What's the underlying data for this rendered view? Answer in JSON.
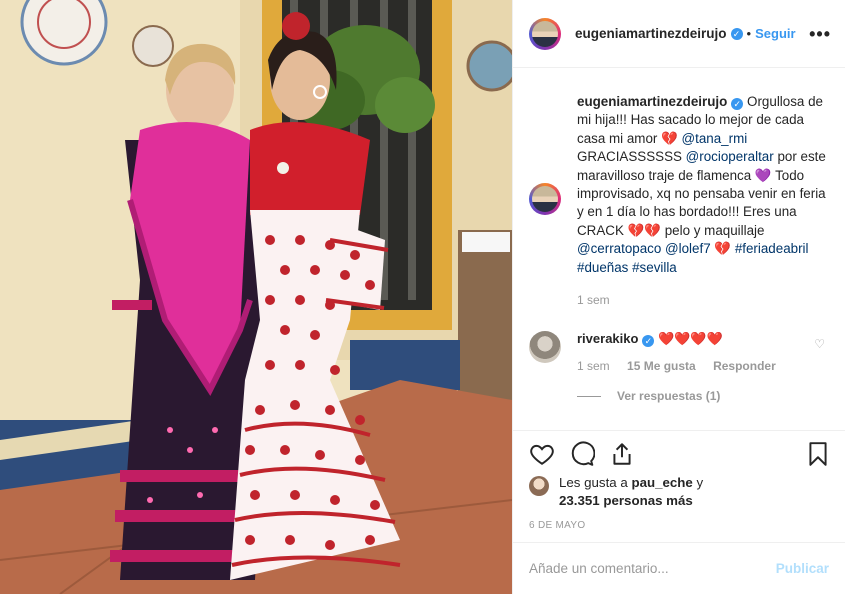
{
  "post": {
    "username": "eugeniamartinezdeirujo",
    "follow_label": "Seguir",
    "more_glyph": "•••",
    "caption_text_1": "Orgullosa de mi hija!!! Has sacado lo mejor de cada casa mi amor",
    "caption_mention_1": "@tana_rmi",
    "caption_text_2": "GRACIASSSSSS",
    "caption_mention_2": "@rocioperaltar",
    "caption_text_3": "por este maravilloso traje de flamenca",
    "caption_text_4": "Todo improvisado, xq no pensaba venir en feria y en 1 día lo has bordado!!! Eres una CRACK",
    "caption_text_5": "pelo y maquillaje",
    "caption_mention_3": "@cerratopaco",
    "caption_mention_4": "@lolef7",
    "caption_tags": "#feriadeabril #dueñas #sevilla",
    "caption_time": "1 sem",
    "emoji_broken_heart": "💔",
    "emoji_purple_heart": "💜"
  },
  "comments": [
    {
      "username": "riverakiko",
      "text": "❤️❤️❤️❤️",
      "time": "1 sem",
      "likes": "15 Me gusta",
      "reply_label": "Responder",
      "view_replies": "Ver respuestas (1)"
    }
  ],
  "likes": {
    "prefix": "Les gusta a",
    "user": "pau_eche",
    "connector": "y",
    "count": "23.351 personas más"
  },
  "date": "6 DE MAYO",
  "add_comment": {
    "placeholder": "Añade un comentario...",
    "publish_label": "Publicar"
  },
  "colors": {
    "accent": "#3897f0",
    "link": "#003569",
    "muted": "#999999",
    "publish_disabled": "#b2dffc",
    "heart": "#e0245e"
  },
  "icons": [
    "verified-icon",
    "more-options-icon",
    "heart-icon",
    "comment-icon",
    "share-icon",
    "bookmark-icon",
    "like-comment-icon"
  ]
}
